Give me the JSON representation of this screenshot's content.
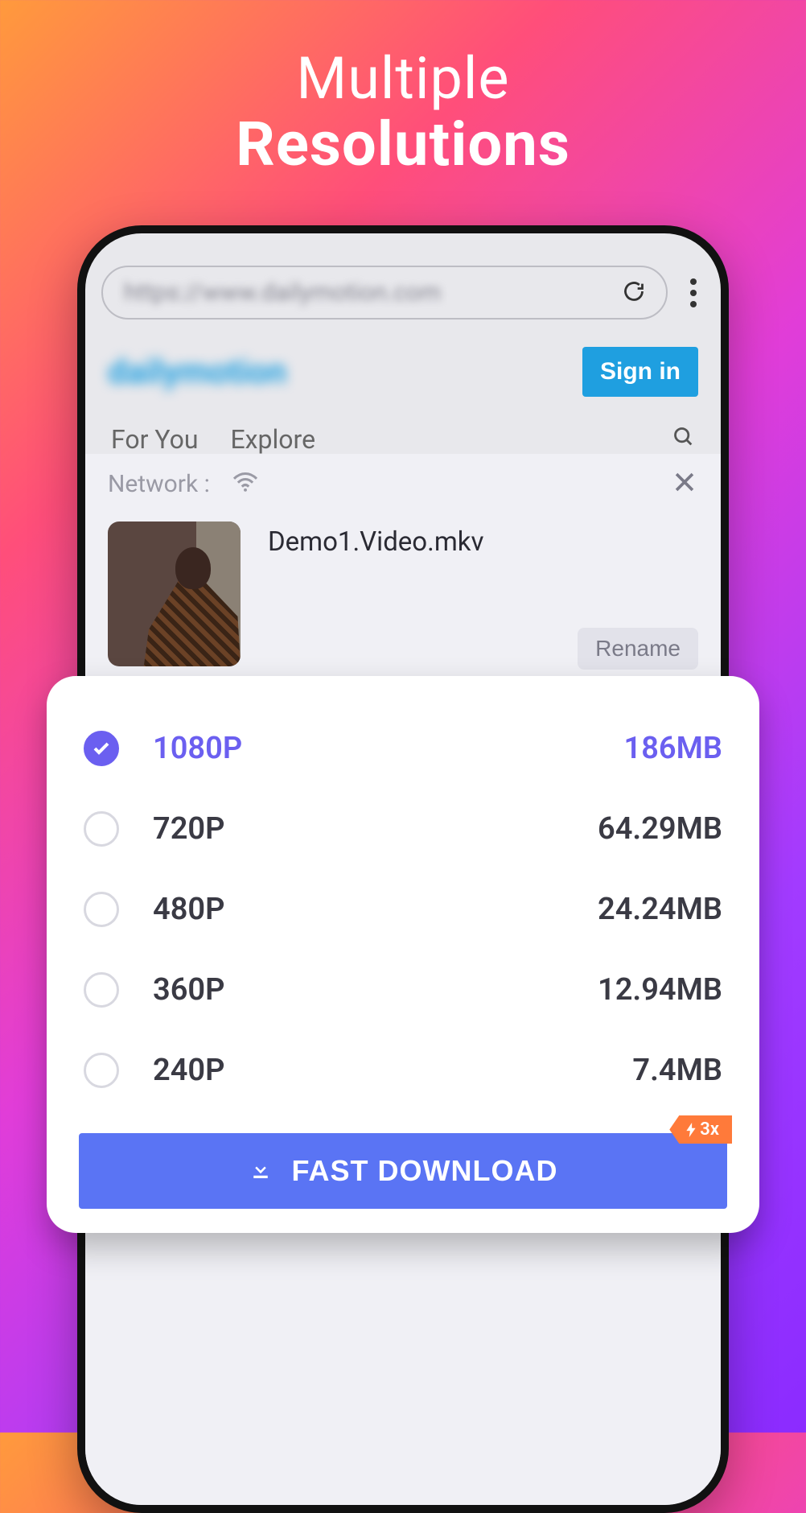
{
  "hero": {
    "line1": "Multiple",
    "line2": "Resolutions"
  },
  "browser": {
    "url_text": "https://www.dailymotion.com",
    "site_logo": "dailymotion",
    "signin": "Sign in",
    "tabs": {
      "for_you": "For You",
      "explore": "Explore"
    }
  },
  "sheet": {
    "network_label": "Network :",
    "file_name": "Demo1.Video.mkv",
    "rename": "Rename"
  },
  "options": [
    {
      "label": "1080P",
      "size": "186MB",
      "checked": true
    },
    {
      "label": "720P",
      "size": "64.29MB",
      "checked": false
    },
    {
      "label": "480P",
      "size": "24.24MB",
      "checked": false
    },
    {
      "label": "360P",
      "size": "12.94MB",
      "checked": false
    },
    {
      "label": "240P",
      "size": "7.4MB",
      "checked": false
    }
  ],
  "download": {
    "label": "FAST DOWNLOAD",
    "badge": "3x"
  }
}
